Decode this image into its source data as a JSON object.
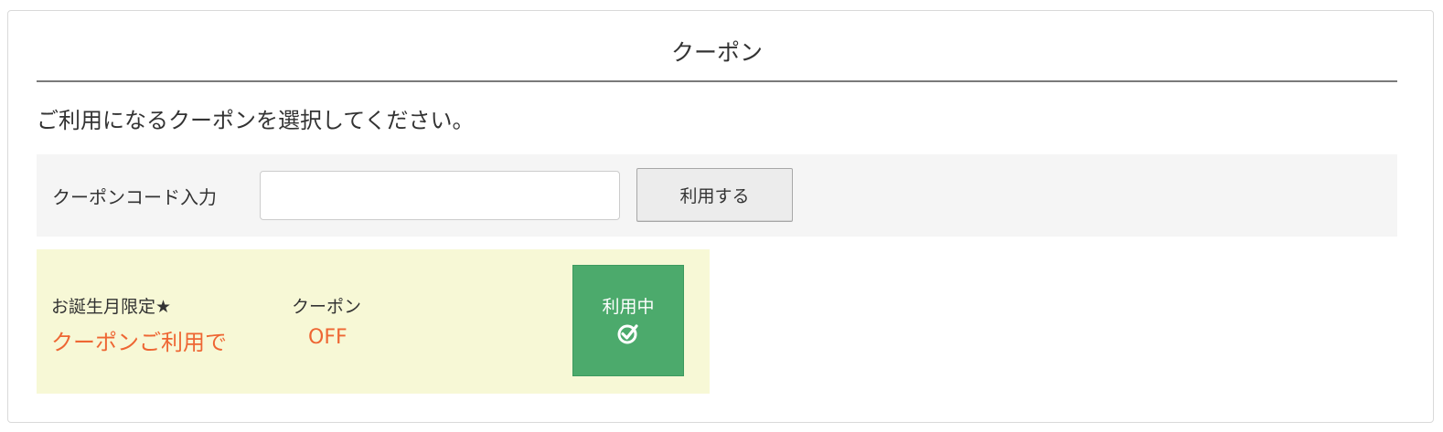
{
  "panel": {
    "title": "クーポン",
    "instruction": "ご利用になるクーポンを選択してください。"
  },
  "code_entry": {
    "label": "クーポンコード入力",
    "input_value": "",
    "input_placeholder": "",
    "apply_label": "利用する"
  },
  "coupons": [
    {
      "name": "お誕生月限定★",
      "type": "クーポン",
      "condition": "クーポンご利用で",
      "discount": "OFF",
      "status_label": "利用中",
      "status_icon": "check-circle-icon"
    }
  ],
  "colors": {
    "accent_orange": "#ee6633",
    "in_use_green": "#4caa6c",
    "coupon_background": "#f7f8d6",
    "code_row_background": "#f5f5f5"
  }
}
